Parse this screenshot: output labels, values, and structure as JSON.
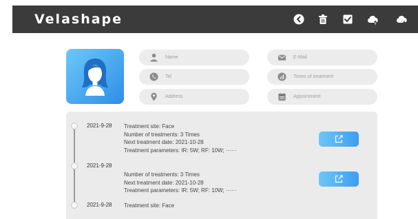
{
  "app": {
    "title": "Velashape"
  },
  "toolbar": {
    "icons": [
      "back-icon",
      "trash-icon",
      "check-box-icon",
      "cloud-upload-icon",
      "cloud-download-icon"
    ]
  },
  "form": {
    "name_placeholder": "Name",
    "email_placeholder": "E-Mail",
    "tel_placeholder": "Tel",
    "times_placeholder": "Times of treatment",
    "address_placeholder": "Address",
    "appointment_placeholder": "Appointment"
  },
  "records": [
    {
      "date": "2021-9-28",
      "lines": [
        "Treatment site: Face",
        "Number of treatments: 3 Times",
        "Next treatment date: 2021-10-28",
        "Treatment parameters: IR:  5W;  RF:  10W;  ······"
      ]
    },
    {
      "date": "2021-9-28",
      "lines": [
        "Number of treatments: 3 Times",
        "Next treatment date: 2021-10-28",
        "Treatment parameters: IR:  5W;  RF:  10W;  ······"
      ]
    },
    {
      "date": "2021-9-28",
      "lines": [
        "Treatment site: Face"
      ]
    }
  ],
  "colors": {
    "header_bg": "#3b3b3b",
    "accent": "#3d9ef0",
    "panel_bg": "#ebebeb",
    "pill_bg": "#ececec"
  }
}
